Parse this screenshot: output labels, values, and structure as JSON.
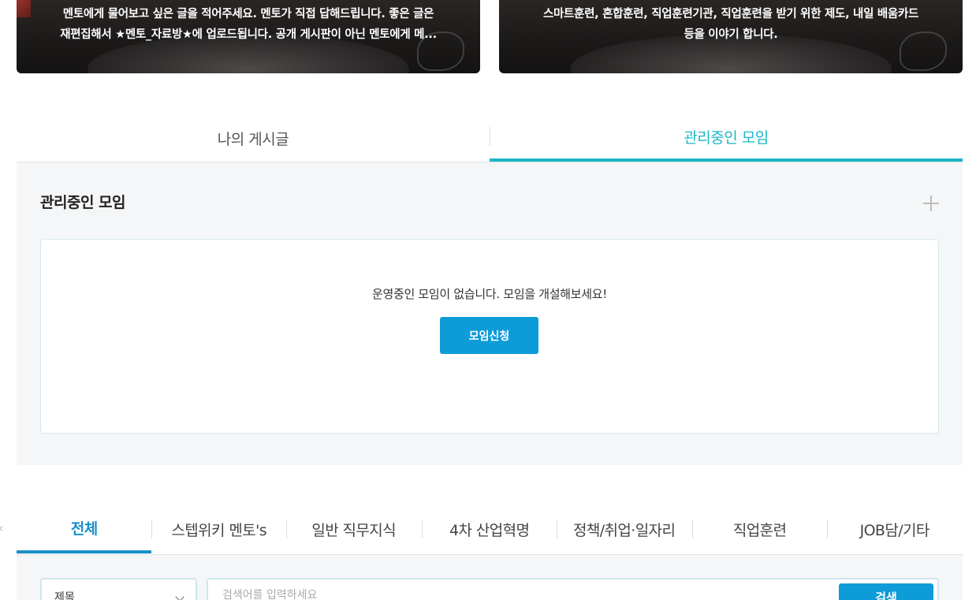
{
  "banners": [
    {
      "line1": "멘토에게 물어보고 싶은 글을 적어주세요. 멘토가 직접 답해드립니다. 좋은 글은",
      "line2": "재편집해서 ★멘토_자료방★에 업로드됩니다. 공개 게시판이 아닌 멘토에게 메..."
    },
    {
      "line1": "스마트훈련, 혼합훈련, 직업훈련기관, 직업훈련을 받기 위한 제도, 내일 배움카드",
      "line2": "등을 이야기 합니다."
    }
  ],
  "top_tabs": {
    "my_posts": "나의 게시글",
    "managed_groups": "관리중인 모임"
  },
  "manage": {
    "title": "관리중인 모임",
    "empty_message": "운영중인 모임이 없습니다. 모임을 개설해보세요!",
    "apply_button": "모임신청"
  },
  "category_tabs": [
    "전체",
    "스텝위키 멘토's",
    "일반 직무지식",
    "4차 산업혁명",
    "정책/취업·일자리",
    "직업훈련",
    "JOB담/기타"
  ],
  "search": {
    "select_value": "제목",
    "placeholder": "검색어를 입력하세요",
    "button": "검색"
  }
}
